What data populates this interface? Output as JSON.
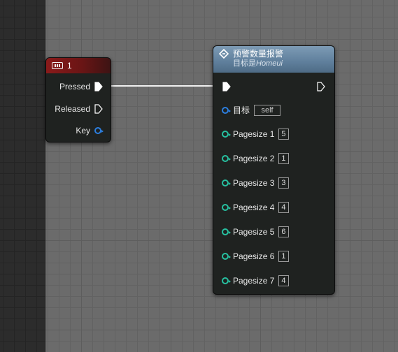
{
  "key_node": {
    "title": "1",
    "pins": {
      "pressed": "Pressed",
      "released": "Released",
      "key": "Key"
    },
    "header_color": "#8a1a1a"
  },
  "func_node": {
    "title": "预警数量报警",
    "subtitle_prefix": "目标是",
    "subtitle_target": "Homeui",
    "header_color": "#6f8eab",
    "target_label": "目标",
    "target_value": "self",
    "inputs": [
      {
        "label": "Pagesize 1",
        "value": "5"
      },
      {
        "label": "Pagesize 2",
        "value": "1"
      },
      {
        "label": "Pagesize 3",
        "value": "3"
      },
      {
        "label": "Pagesize 4",
        "value": "4"
      },
      {
        "label": "Pagesize 5",
        "value": "6"
      },
      {
        "label": "Pagesize 6",
        "value": "1"
      },
      {
        "label": "Pagesize 7",
        "value": "4"
      }
    ]
  },
  "colors": {
    "object_pin": "#2c7fe0",
    "int_pin": "#27c0a0",
    "exec_pin": "#ffffff"
  },
  "icons": {
    "key_node": "keyboard-icon",
    "func_node": "function-icon"
  }
}
